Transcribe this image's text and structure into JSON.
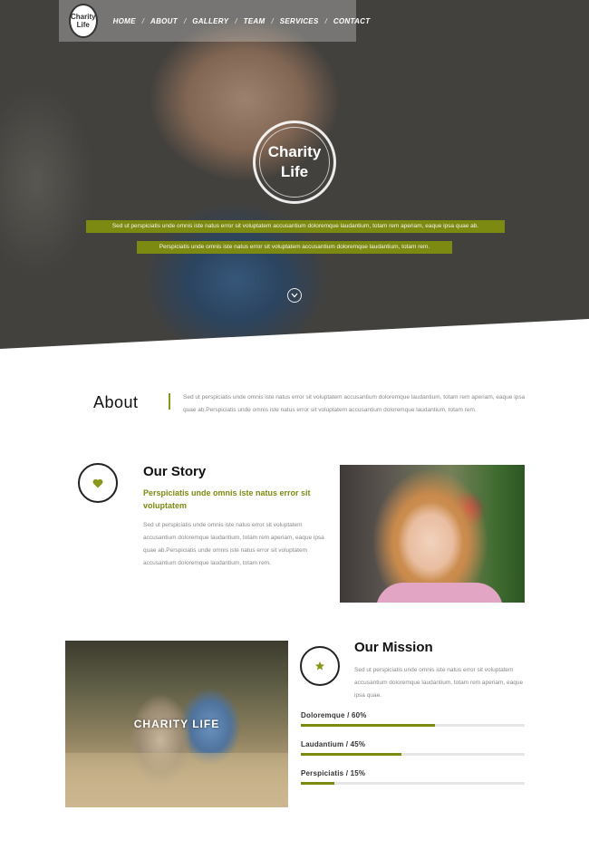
{
  "nav": {
    "logo_line1": "Charity",
    "logo_line2": "Life",
    "items": [
      "HOME",
      "ABOUT",
      "GALLERY",
      "TEAM",
      "SERVICES",
      "CONTACT"
    ],
    "separator": "/"
  },
  "hero": {
    "logo_line1": "Charity",
    "logo_line2": "Life",
    "strip1": "Sed ut perspiciatis unde omnis iste natus error sit voluptatem accusantium doloremque laudantium, totam rem aperiam, eaque ipsa quae ab.",
    "strip2": "Perspiciatis unde omnis iste natus error sit voluptatem accusantium doloremque laudantium, totam rem.",
    "down_icon": "chevron-down-icon"
  },
  "about": {
    "title": "About",
    "text": "Sed ut perspiciatis unde omnis iste natus error sit voluptatem accusantium doloremque laudantium, totam rem aperiam, eaque ipsa quae ab.Perspiciatis unde omnis iste natus error sit voluptatem accusantium doloremque laudantium, totam rem."
  },
  "story": {
    "icon": "heart-icon",
    "title": "Our Story",
    "subtitle": "Perspiciatis unde omnis iste natus error sit voluptatem",
    "text": "Sed ut perspiciatis unde omnis iste natus error sit voluptatem accusantium doloremque laudantium, totam rem aperiam, eaque ipsa quae ab.Perspiciatis unde omnis iste natus error sit voluptatem accusantium doloremque laudantium, totam rem."
  },
  "mission": {
    "icon": "star-icon",
    "title": "Our Mission",
    "text": "Sed ut perspiciatis unde omnis iste natus error sit voluptatem accusantium doloremque laudantium, totam rem aperiam, eaque ipsa quae.",
    "photo_label": "CHARITY LIFE",
    "skills": [
      {
        "label": "Doloremque / 60%",
        "percent": 60
      },
      {
        "label": "Laudantium / 45%",
        "percent": 45
      },
      {
        "label": "Perspiciatis / 15%",
        "percent": 15
      }
    ]
  },
  "colors": {
    "accent": "#7d8a12",
    "heading": "#111111",
    "body_text": "#888888"
  }
}
